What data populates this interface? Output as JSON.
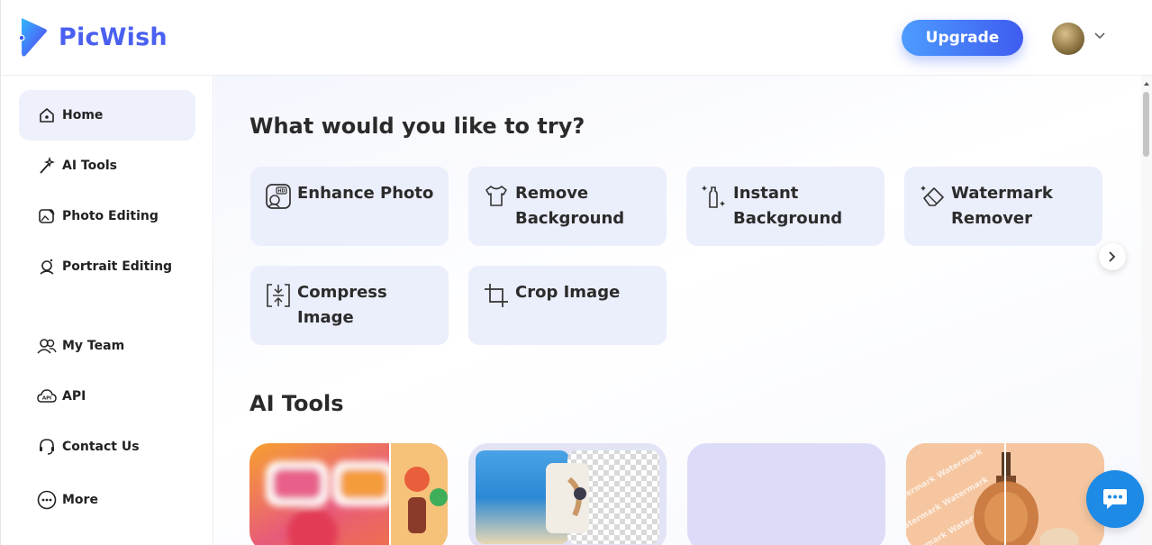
{
  "header": {
    "brand": "PicWish",
    "upgrade_label": "Upgrade"
  },
  "sidebar": {
    "items": [
      {
        "label": "Home",
        "icon": "home-icon"
      },
      {
        "label": "AI Tools",
        "icon": "magic-wand-icon"
      },
      {
        "label": "Photo Editing",
        "icon": "photo-edit-icon"
      },
      {
        "label": "Portrait Editing",
        "icon": "portrait-icon"
      },
      {
        "label": "My Team",
        "icon": "team-icon"
      },
      {
        "label": "API",
        "icon": "api-cloud-icon"
      },
      {
        "label": "Contact Us",
        "icon": "headset-icon"
      },
      {
        "label": "More",
        "icon": "more-icon"
      }
    ]
  },
  "main": {
    "try_heading": "What would you like to try?",
    "quick_tools": [
      {
        "label": "Enhance Photo",
        "icon": "hd-photo-icon"
      },
      {
        "label": "Remove Background",
        "icon": "shirt-icon"
      },
      {
        "label": "Instant Background",
        "icon": "bottle-sparkle-icon"
      },
      {
        "label": "Watermark Remover",
        "icon": "eraser-icon"
      },
      {
        "label": "Compress Image",
        "icon": "compress-icon"
      },
      {
        "label": "Crop Image",
        "icon": "crop-icon"
      }
    ],
    "ai_tools_heading": "AI Tools",
    "thumbnail_watermark_text": "Watermark"
  },
  "colors": {
    "brand": "#4a60f0",
    "card_bg": "#ebeefb",
    "chat": "#1d8ae6"
  }
}
